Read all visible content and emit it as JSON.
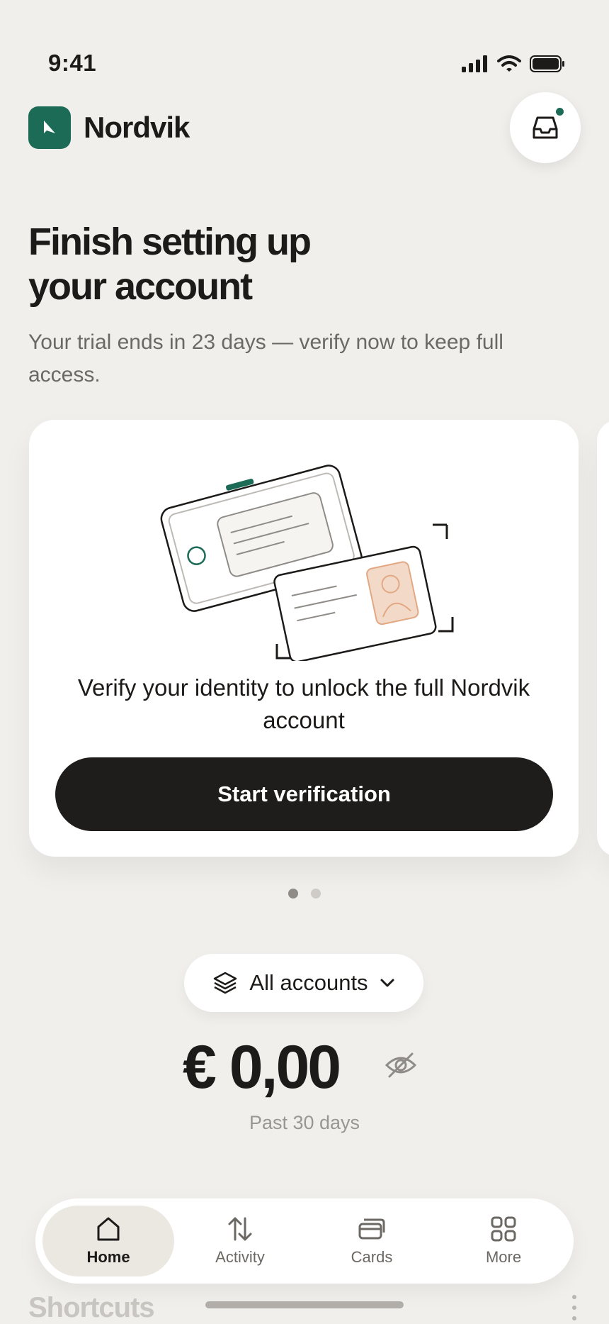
{
  "status_bar": {
    "time": "9:41"
  },
  "header": {
    "app_name": "Nordvik"
  },
  "onboarding": {
    "title": "Finish setting up\nyour account",
    "subtitle": "Your trial ends in 23 days — verify now to keep full access."
  },
  "card": {
    "message": "Verify your identity to unlock the full Nordvik account",
    "button_label": "Start verification"
  },
  "carousel": {
    "count": 2,
    "active_index": 0
  },
  "accounts": {
    "selector_label": "All accounts",
    "balance": "€ 0,00",
    "period": "Past 30 days"
  },
  "tabbar": {
    "items": [
      {
        "label": "Home",
        "icon": "home-icon",
        "active": true
      },
      {
        "label": "Activity",
        "icon": "activity-icon",
        "active": false
      },
      {
        "label": "Cards",
        "icon": "cards-icon",
        "active": false
      },
      {
        "label": "More",
        "icon": "grid-icon",
        "active": false
      }
    ]
  },
  "section": {
    "shortcuts_title": "Shortcuts"
  },
  "colors": {
    "brand": "#1c6b57",
    "background": "#f0efec",
    "button_dark": "#1f1d1b",
    "accent_peach": "#f3d9c8"
  }
}
